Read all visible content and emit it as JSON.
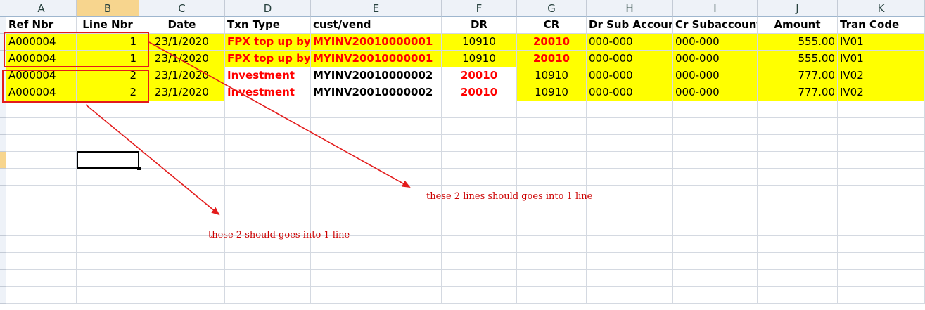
{
  "columns": [
    "A",
    "B",
    "C",
    "D",
    "E",
    "F",
    "G",
    "H",
    "I",
    "J",
    "K"
  ],
  "selected_column": "B",
  "header_row": [
    "Ref Nbr",
    "Line Nbr",
    "Date",
    "Txn Type",
    "cust/vend",
    "DR",
    "CR",
    "Dr Sub Account",
    "Cr Subaccount",
    "Amount",
    "Tran Code"
  ],
  "rows": [
    {
      "ref": "A000004",
      "line": "1",
      "date": "23/1/2020",
      "txn": "FPX top up by Ir",
      "cust": "MYINV20010000001",
      "dr": "10910",
      "cr": "20010",
      "drsub": "000-000",
      "crsub": "000-000",
      "amount": "555.00",
      "code": "IV01"
    },
    {
      "ref": "A000004",
      "line": "1",
      "date": "23/1/2020",
      "txn": "FPX top up by Ir",
      "cust": "MYINV20010000001",
      "dr": "10910",
      "cr": "20010",
      "drsub": "000-000",
      "crsub": "000-000",
      "amount": "555.00",
      "code": "IV01"
    },
    {
      "ref": "A000004",
      "line": "2",
      "date": "23/1/2020",
      "txn": "Investment",
      "cust": "MYINV20010000002",
      "dr": "20010",
      "cr": "10910",
      "drsub": "000-000",
      "crsub": "000-000",
      "amount": "777.00",
      "code": "IV02"
    },
    {
      "ref": "A000004",
      "line": "2",
      "date": "23/1/2020",
      "txn": "Investment",
      "cust": "MYINV20010000002",
      "dr": "20010",
      "cr": "10910",
      "drsub": "000-000",
      "crsub": "000-000",
      "amount": "777.00",
      "code": "IV02"
    }
  ],
  "annotations": {
    "note_lines_1": "these 2 lines should goes into 1 line",
    "note_lines_2": "these 2 should goes into 1 line"
  },
  "colors": {
    "highlight": "#ffff00",
    "annotation_red": "#e31b1b",
    "text_red": "#ff0000"
  }
}
